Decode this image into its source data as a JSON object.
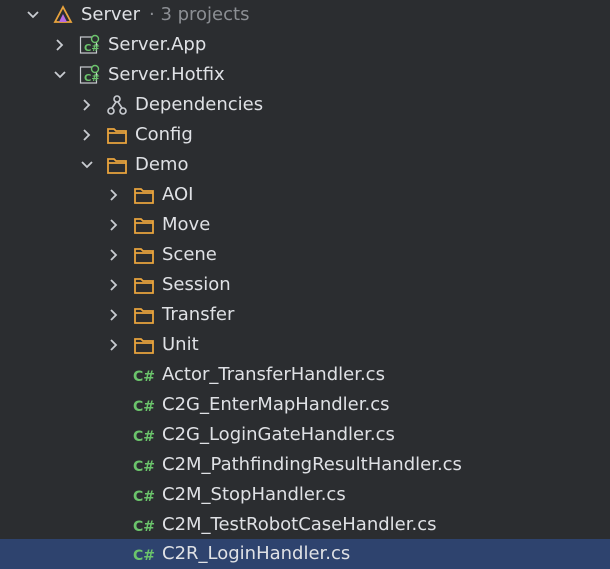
{
  "colors": {
    "background": "#2b2d30",
    "text": "#dfe1e5",
    "muted": "#8c8f94",
    "selection": "#2e436e",
    "folder": "#e8a33d",
    "csharp": "#6bc46b",
    "solution": "#b66be0"
  },
  "solution": {
    "name": "Server",
    "suffix": "· 3 projects",
    "icon": "solution-icon"
  },
  "projects": [
    {
      "name": "Server.App",
      "icon": "csharp-project-icon",
      "expanded": false
    },
    {
      "name": "Server.Hotfix",
      "icon": "csharp-project-icon",
      "expanded": true
    }
  ],
  "hotfix": {
    "dependencies": "Dependencies",
    "config": "Config",
    "demo": "Demo",
    "demo_folders": [
      "AOI",
      "Move",
      "Scene",
      "Session",
      "Transfer",
      "Unit"
    ],
    "demo_files": [
      "Actor_TransferHandler.cs",
      "C2G_EnterMapHandler.cs",
      "C2G_LoginGateHandler.cs",
      "C2M_PathfindingResultHandler.cs",
      "C2M_StopHandler.cs",
      "C2M_TestRobotCaseHandler.cs",
      "C2R_LoginHandler.cs"
    ],
    "selected_file": "C2R_LoginHandler.cs"
  }
}
